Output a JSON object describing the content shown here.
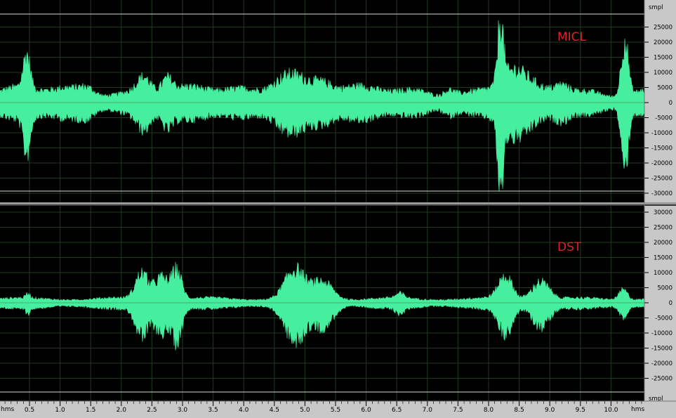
{
  "channels": [
    {
      "label": "MICL",
      "label_color": "#e0202a",
      "unit": "smpl",
      "ticks": [
        "25000",
        "20000",
        "15000",
        "10000",
        "5000",
        "0",
        "-5000",
        "-10000",
        "-15000",
        "-20000",
        "-25000",
        "-30000"
      ]
    },
    {
      "label": "DST",
      "label_color": "#e0202a",
      "unit": "smpl",
      "ticks": [
        "30000",
        "25000",
        "20000",
        "15000",
        "10000",
        "5000",
        "0",
        "-5000",
        "-10000",
        "-15000",
        "-20000",
        "-25000"
      ]
    }
  ],
  "time_ruler": {
    "unit_left": "hms",
    "unit_right": "hms",
    "labels": [
      "0.5",
      "1.0",
      "1.5",
      "2.0",
      "2.5",
      "3.0",
      "3.5",
      "4.0",
      "4.5",
      "5.0",
      "5.5",
      "6.0",
      "6.5",
      "7.0",
      "7.5",
      "8.0",
      "8.5",
      "9.0",
      "9.5",
      "10.0"
    ]
  },
  "colors": {
    "waveform": "#45ef9e",
    "background": "#000000",
    "grid": "#1f3a1f",
    "centerline": "#50aa70",
    "ruler_bg": "#c8c8c8"
  }
}
